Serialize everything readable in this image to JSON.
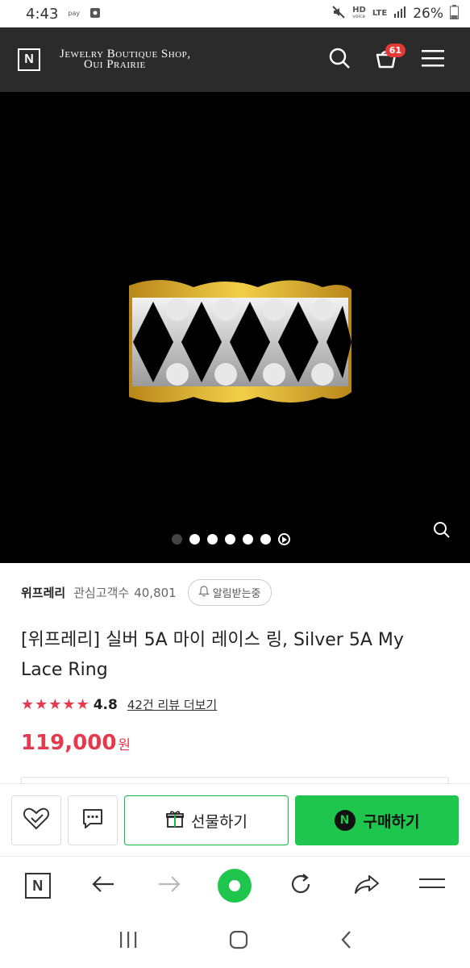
{
  "status_bar": {
    "time": "4:43",
    "pay_label": "pay",
    "hd_label": "HD",
    "voice_label": "voice",
    "lte_label": "LTE",
    "battery": "26%"
  },
  "header": {
    "logo_letter": "N",
    "shop_line1": "Jewelry Boutique Shop,",
    "shop_line2": "Oui Prairie",
    "cart_count": "61"
  },
  "gallery": {
    "slide_count": 7,
    "active_index": 0
  },
  "seller": {
    "name": "위프레리",
    "fans_label": "관심고객수",
    "fans_count": "40,801",
    "alert_label": "알림받는중"
  },
  "product": {
    "title": "[위프레리] 실버 5A 마이 레이스 링, Silver 5A My Lace Ring",
    "stars": "★★★★★",
    "rating": "4.8",
    "review_link": "42건 리뷰 더보기",
    "price": "119,000",
    "price_unit": "원"
  },
  "actions": {
    "gift_label": "선물하기",
    "npay_letter": "N",
    "buy_label": "구매하기"
  },
  "browser": {
    "logo_letter": "N"
  },
  "colors": {
    "accent_green": "#1fc64d",
    "price_red": "#e53a4d",
    "header_bg": "#2b2b2b"
  }
}
